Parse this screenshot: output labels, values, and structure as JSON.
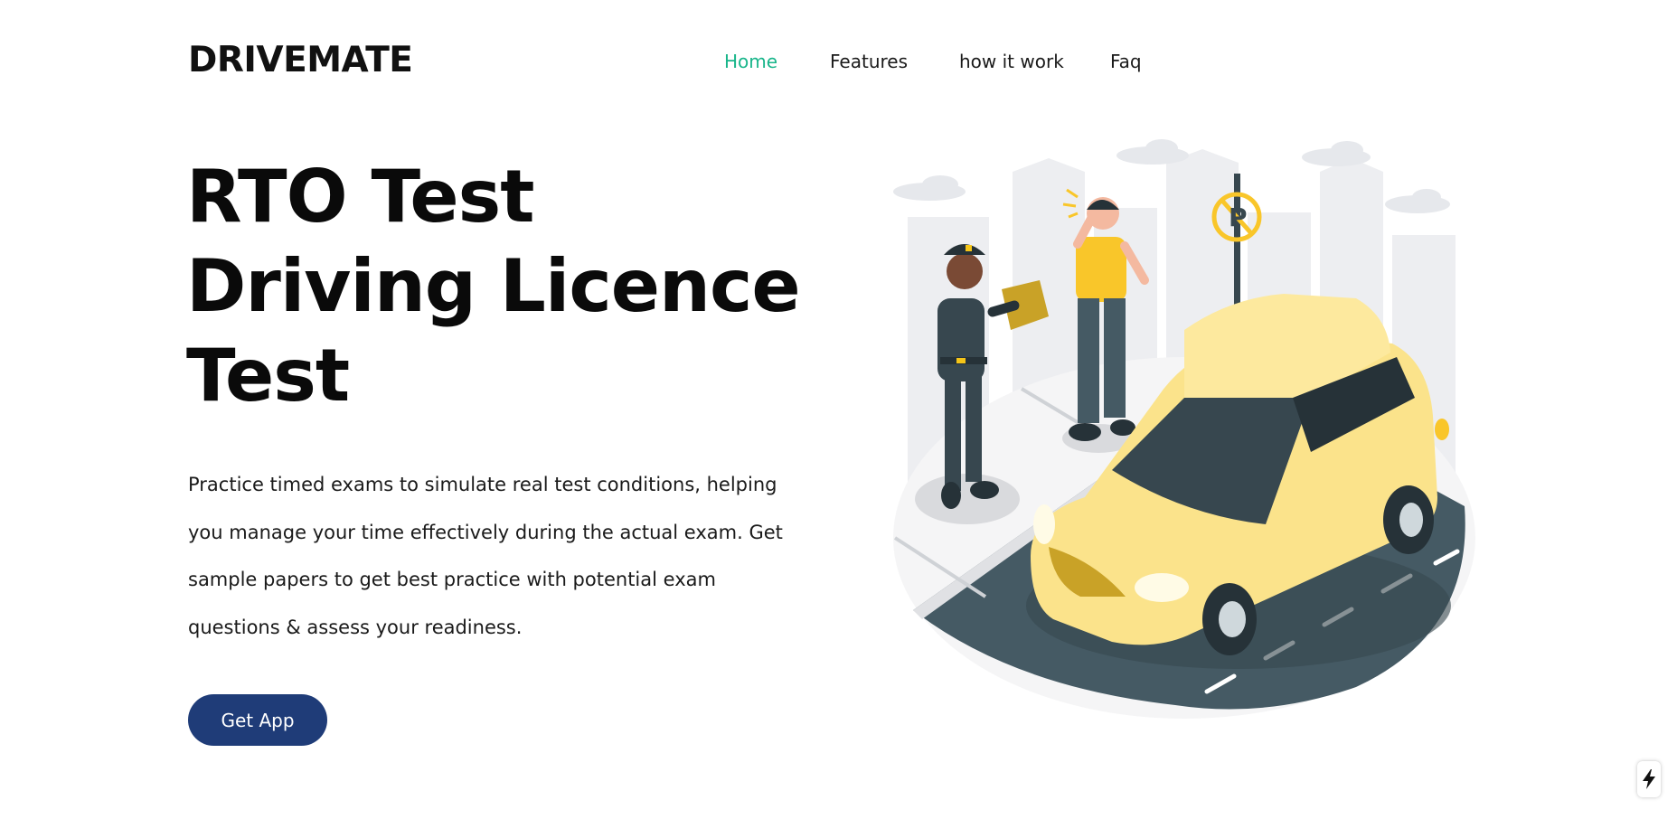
{
  "header": {
    "logo": "DRIVEMATE",
    "nav": [
      {
        "label": "Home",
        "active": true
      },
      {
        "label": "Features",
        "active": false
      },
      {
        "label": "how it work",
        "active": false
      },
      {
        "label": "Faq",
        "active": false
      }
    ]
  },
  "hero": {
    "title_lines": [
      "RTO Test",
      "Driving Licence",
      "Test"
    ],
    "description": "Practice timed exams to simulate real test conditions, helping you manage your time effectively during the actual exam. Get sample papers to get best practice with potential exam questions & assess your readiness.",
    "cta_label": "Get App"
  },
  "illustration": {
    "subject": "traffic-police-officer-writing-ticket-for-driver-beside-yellow-car"
  },
  "icons": {
    "corner_badge": "lightning-bolt-icon"
  },
  "colors": {
    "accent_active": "#18b58a",
    "button_bg": "#1f3c78",
    "car_yellow": "#fbe38b",
    "road": "#455a64"
  }
}
